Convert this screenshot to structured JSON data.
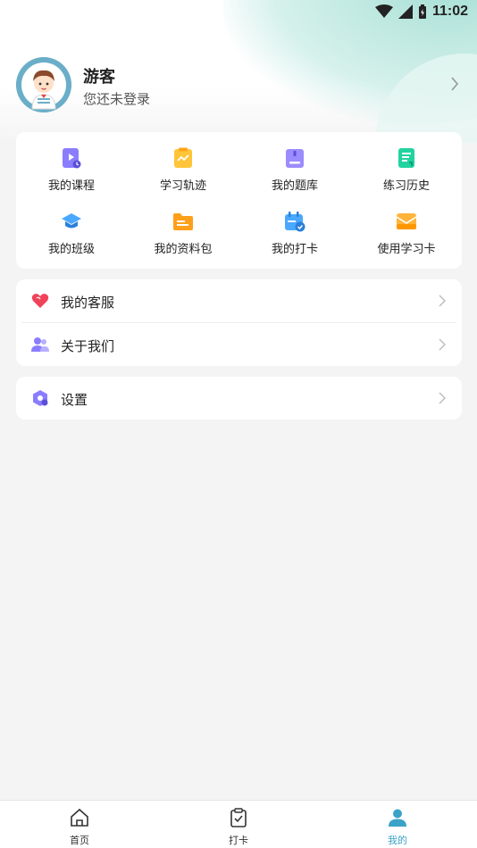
{
  "status_bar": {
    "time": "11:02"
  },
  "profile": {
    "name": "游客",
    "hint": "您还未登录"
  },
  "grid": [
    {
      "label": "我的课程",
      "icon": "video-course-icon",
      "color": "#8a7dff"
    },
    {
      "label": "学习轨迹",
      "icon": "trend-chart-icon",
      "color": "#ffc53a"
    },
    {
      "label": "我的题库",
      "icon": "question-bank-icon",
      "color": "#9b8cff"
    },
    {
      "label": "练习历史",
      "icon": "practice-history-icon",
      "color": "#22d3a0"
    },
    {
      "label": "我的班级",
      "icon": "graduation-cap-icon",
      "color": "#4aa8ff"
    },
    {
      "label": "我的资料包",
      "icon": "folder-icon",
      "color": "#ff9f1a"
    },
    {
      "label": "我的打卡",
      "icon": "calendar-check-icon",
      "color": "#4aa8ff"
    },
    {
      "label": "使用学习卡",
      "icon": "study-card-icon",
      "color": "#ffb43a"
    }
  ],
  "menu": [
    {
      "label": "我的客服",
      "icon": "heart-icon",
      "color": "#f0435a"
    },
    {
      "label": "关于我们",
      "icon": "users-icon",
      "color": "#8a7dff"
    }
  ],
  "settings": {
    "label": "设置",
    "icon": "settings-hexagon-icon",
    "color": "#8a7dff"
  },
  "tabs": [
    {
      "label": "首页",
      "icon": "home-icon"
    },
    {
      "label": "打卡",
      "icon": "clipboard-check-icon"
    },
    {
      "label": "我的",
      "icon": "person-icon",
      "active": true
    }
  ],
  "colors": {
    "accent": "#3ba2c8",
    "background": "#f4f4f4",
    "card": "#ffffff"
  }
}
